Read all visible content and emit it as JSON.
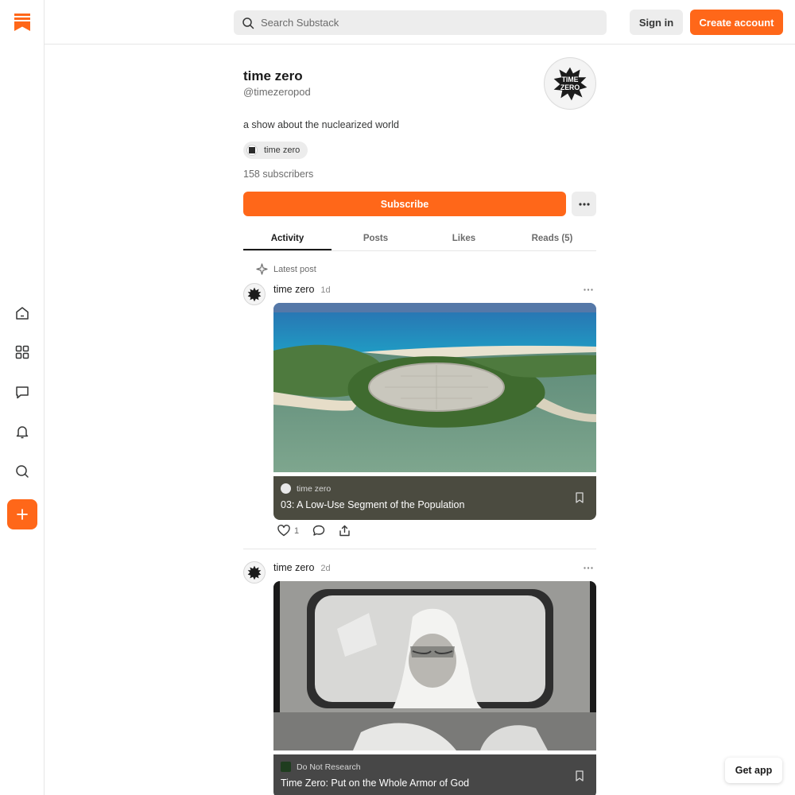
{
  "colors": {
    "accent": "#ff6719",
    "text": "#363737",
    "muted": "#6b6b6b",
    "card_footer": "#4b4b40"
  },
  "rail": {
    "logo": "substack-logo-icon",
    "items": [
      {
        "name": "home-icon"
      },
      {
        "name": "explore-grid-icon"
      },
      {
        "name": "chat-icon"
      },
      {
        "name": "bell-icon"
      },
      {
        "name": "search-icon"
      }
    ],
    "compose": "plus-icon"
  },
  "topbar": {
    "search_placeholder": "Search Substack",
    "signin_label": "Sign in",
    "create_label": "Create account"
  },
  "profile": {
    "name": "time zero",
    "handle": "@timezeropod",
    "avatar_text_1": "TIME",
    "avatar_text_2": "ZERO",
    "bio": "a show about the nuclearized world",
    "publication_chip": "time zero",
    "subscribers": "158 subscribers",
    "subscribe_label": "Subscribe"
  },
  "tabs": [
    {
      "label": "Activity",
      "active": true
    },
    {
      "label": "Posts",
      "active": false
    },
    {
      "label": "Likes",
      "active": false
    },
    {
      "label": "Reads (5)",
      "active": false
    }
  ],
  "latest_label": "Latest post",
  "posts": [
    {
      "author": "time zero",
      "time": "1d",
      "image": "aerial photo of a concrete dome on an island beside turquoise ocean",
      "publication": "time zero",
      "title": "03: A Low-Use Segment of the Population",
      "likes": "1"
    },
    {
      "author": "time zero",
      "time": "2d",
      "image": "black and white photo of a person in protective hood and goggles behind a glass window",
      "publication": "Do Not Research",
      "title": "Time Zero: Put on the Whole Armor of God"
    }
  ],
  "get_app_label": "Get app"
}
